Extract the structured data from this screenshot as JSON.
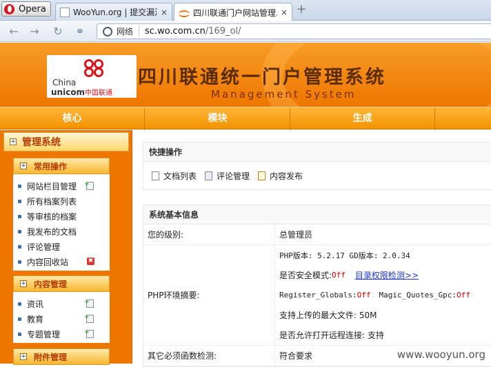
{
  "browser": {
    "menu_label": "Opera",
    "tabs": [
      {
        "title": "WooYun.org | 提交漏洞"
      },
      {
        "title": "四川联通门户网站管理..."
      }
    ],
    "close_glyph": "×",
    "newtab_glyph": "+",
    "security_label": "网络",
    "url_host": "sc.wo.com.cn",
    "url_path": "/169_ol/"
  },
  "header": {
    "logo_china": "China",
    "logo_unicom": "unicom",
    "logo_cn": "中国联通",
    "title": "四川联通统一门户管理系统",
    "subtitle": "Management System"
  },
  "mainnav": [
    "核心",
    "模块",
    "生成"
  ],
  "sidebar": {
    "title": "管理系统",
    "groups": [
      {
        "title": "常用操作",
        "items": [
          "网站栏目管理",
          "所有档案列表",
          "等审核的档案",
          "我发布的文档",
          "评论管理",
          "内容回收站"
        ]
      },
      {
        "title": "内容管理",
        "items": [
          "资讯",
          "教育",
          "专题管理"
        ]
      },
      {
        "title": "附件管理",
        "items": []
      }
    ]
  },
  "quick": {
    "title": "快捷操作",
    "items": [
      "文档列表",
      "评论管理",
      "内容发布"
    ]
  },
  "sysinfo": {
    "title": "系统基本信息",
    "level_label": "您的级别:",
    "level_value": "总管理员",
    "php_label": "PHP环境摘要:",
    "php_version": "PHP版本: 5.2.17   GD版本: 2.0.34",
    "safe_mode_label": "是否安全模式:",
    "safe_mode_value": "Off",
    "dir_check_link": "目录权限检测>>",
    "register_globals_label": "Register_Globals:",
    "register_globals_value": "Off",
    "magic_quotes_label": "Magic_Quotes_Gpc:",
    "magic_quotes_value": "Off",
    "max_upload": "支持上传的最大文件: 50M",
    "remote_conn": "是否允许打开远程连接: 支持",
    "func_label": "其它必须函数检测:",
    "func_value": "符合要求"
  },
  "watermark": "www.wooyun.org"
}
